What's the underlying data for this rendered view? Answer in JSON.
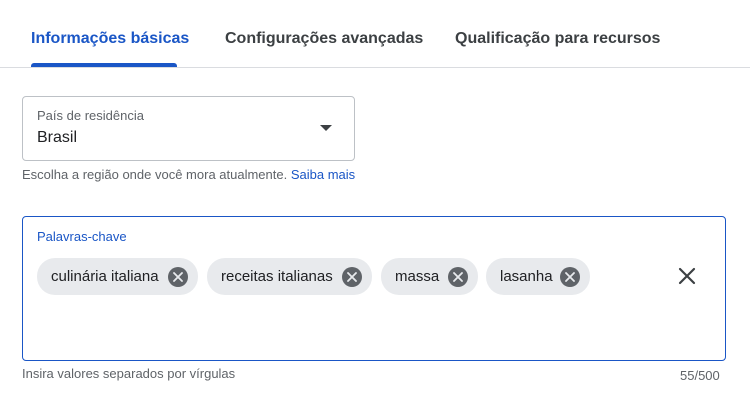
{
  "tabs": [
    {
      "label": "Informações básicas",
      "active": true
    },
    {
      "label": "Configurações avançadas",
      "active": false
    },
    {
      "label": "Qualificação para recursos",
      "active": false
    }
  ],
  "country_select": {
    "label": "País de residência",
    "value": "Brasil",
    "icon": "arrow-drop-down-icon"
  },
  "country_help": {
    "text": "Escolha a região onde você mora atualmente.",
    "link": "Saiba mais"
  },
  "keywords": {
    "label": "Palavras-chave",
    "chips": [
      "culinária italiana",
      "receitas italianas",
      "massa",
      "lasanha"
    ],
    "chip_remove_icon": "cancel-circle-icon",
    "clear_icon": "close-icon",
    "help": "Insira valores separados por vírgulas",
    "counter": "55/500"
  },
  "colors": {
    "accent": "#1a56c6",
    "chip_bg": "#e8eaed",
    "muted_text": "#5f6368"
  }
}
